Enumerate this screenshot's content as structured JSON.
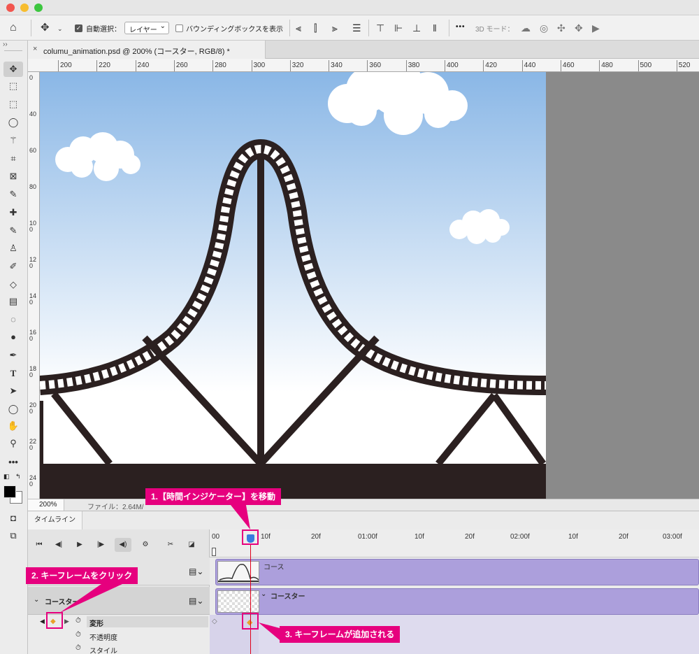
{
  "window": {
    "traffic_colors": [
      "#f2564f",
      "#f7bd2f",
      "#3cc63f"
    ]
  },
  "options_bar": {
    "auto_select_label": "自動選択：",
    "auto_select_value": "レイヤー",
    "bounding_box_label": "バウンディングボックスを表示",
    "more_label": "•••",
    "mode_3d_label": "3D モード："
  },
  "document": {
    "tab_title": "columu_animation.psd @ 200% (コースター, RGB/8) *",
    "close_symbol": "×"
  },
  "toolbar": {
    "collapse_symbol": "››",
    "more_tools": "•••"
  },
  "ruler": {
    "h_labels": [
      "200",
      "220",
      "240",
      "260",
      "280",
      "300",
      "320",
      "340",
      "360",
      "380",
      "400",
      "420",
      "440",
      "460",
      "480",
      "500",
      "520"
    ],
    "v_labels": [
      "0",
      "40",
      "60",
      "80",
      "100",
      "120",
      "140",
      "160",
      "180",
      "200",
      "220",
      "240"
    ]
  },
  "status": {
    "zoom": "200%",
    "file_info": "ファイル：2.64M/"
  },
  "timeline": {
    "tab_label": "タイムライン",
    "ticks": [
      "00",
      "10f",
      "20f",
      "01:00f",
      "10f",
      "20f",
      "02:00f",
      "10f",
      "20f",
      "03:00f"
    ],
    "layers": [
      {
        "name": "コース"
      },
      {
        "name": "コースター"
      }
    ],
    "group_label": "コースター",
    "properties": [
      "変形",
      "不透明度",
      "スタイル"
    ],
    "current_time_fraction": 0.68
  },
  "callouts": {
    "step1": "1.【時間インジケーター】を移動",
    "step2": "2. キーフレームをクリック",
    "step3": "3. キーフレームが追加される"
  },
  "colors": {
    "accent": "#e6007e",
    "sky_top": "#8ab7e6",
    "sky_bottom": "#ffffff",
    "track": "#2b2020",
    "clip": "#ac9fdc",
    "keyframe": "#e8a02a"
  }
}
